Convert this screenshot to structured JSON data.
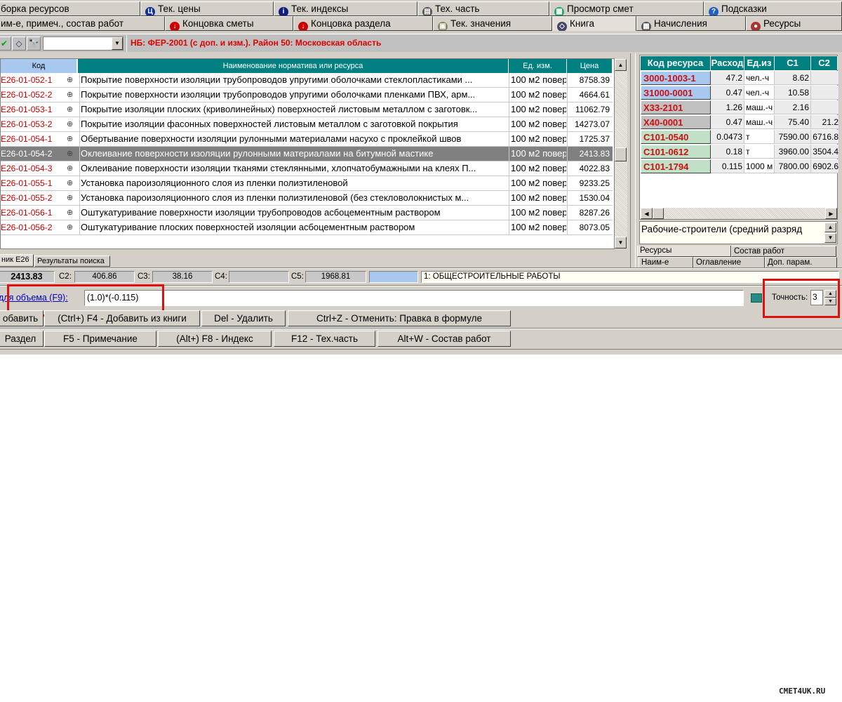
{
  "tabs_row1": [
    {
      "label": "борка ресурсов",
      "icon": ""
    },
    {
      "label": "Тек. цены",
      "icon": "prices-icon"
    },
    {
      "label": "Тек. индексы",
      "icon": "info-icon"
    },
    {
      "label": "Тех. часть",
      "icon": "pages-icon"
    },
    {
      "label": "Просмотр смет",
      "icon": "view-estimate-icon"
    },
    {
      "label": "Подсказки",
      "icon": "help-icon"
    }
  ],
  "tabs_row2": [
    {
      "label": "им-е, примеч., состав работ",
      "icon": ""
    },
    {
      "label": "Концовка сметы",
      "icon": "arrow-down-icon"
    },
    {
      "label": "Концовка раздела",
      "icon": "arrow-down-r-icon"
    },
    {
      "label": "Тек. значения",
      "icon": "values-icon"
    },
    {
      "label": "Книга",
      "icon": "book-icon"
    },
    {
      "label": "Начисления",
      "icon": "calculator-icon"
    },
    {
      "label": "Ресурсы",
      "icon": "resources-icon"
    }
  ],
  "toolbar": {
    "combo_value": "",
    "base_info": "НБ: ФЕР-2001 (с доп. и изм.). Район 50: Московская область"
  },
  "grid": {
    "headers": [
      "Код",
      "Наименование норматива или ресурса",
      "Ед. изм.",
      "Цена"
    ],
    "rows": [
      {
        "code": "E26-01-052-1",
        "name": "Покрытие поверхности изоляции трубопроводов упругими оболочками стеклопластиками ...",
        "unit": "100 м2 повер",
        "price": "8758.39"
      },
      {
        "code": "E26-01-052-2",
        "name": "Покрытие поверхности изоляции трубопроводов упругими оболочками пленками ПВХ, арм...",
        "unit": "100 м2 повер",
        "price": "4664.61"
      },
      {
        "code": "E26-01-053-1",
        "name": "Покрытие изоляции плоских (криволинейных) поверхностей листовым металлом с заготовк...",
        "unit": "100 м2 повер",
        "price": "11062.79"
      },
      {
        "code": "E26-01-053-2",
        "name": "Покрытие изоляции фасонных поверхностей листовым металлом с заготовкой покрытия",
        "unit": "100 м2 повер",
        "price": "14273.07"
      },
      {
        "code": "E26-01-054-1",
        "name": "Обертывание поверхности изоляции рулонными материалами насухо с проклейкой швов",
        "unit": "100 м2 повер",
        "price": "1725.37"
      },
      {
        "code": "E26-01-054-2",
        "name": "Оклеивание поверхности изоляции рулонными материалами на битумной мастике",
        "unit": "100 м2 повер",
        "price": "2413.83"
      },
      {
        "code": "E26-01-054-3",
        "name": "Оклеивание поверхности изоляции тканями стеклянными, хлопчатобумажными на клеях П...",
        "unit": "100 м2 повер",
        "price": "4022.83"
      },
      {
        "code": "E26-01-055-1",
        "name": "Установка пароизоляционного слоя из пленки полиэтиленовой",
        "unit": "100 м2 повер",
        "price": "9233.25"
      },
      {
        "code": "E26-01-055-2",
        "name": "Установка пароизоляционного слоя из пленки полиэтиленовой (без стекловолокнистых м...",
        "unit": "100 м2 повер",
        "price": "1530.04"
      },
      {
        "code": "E26-01-056-1",
        "name": "Оштукатуривание поверхности изоляции трубопроводов асбоцементным раствором",
        "unit": "100 м2 повер",
        "price": "8287.26"
      },
      {
        "code": "E26-01-056-2",
        "name": "Оштукатуривание плоских поверхностей изоляции асбоцементным раствором",
        "unit": "100 м2 повер",
        "price": "8073.05"
      }
    ]
  },
  "resources": {
    "headers": [
      "Код ресурса",
      "Расход",
      "Ед.из",
      "C1",
      "C2"
    ],
    "rows": [
      {
        "code": "З000-1003-1",
        "qty": "47.2",
        "unit": "чел.-ч",
        "c1": "8.62",
        "c2": "",
        "color": "#a8c8f0"
      },
      {
        "code": "З1000-0001",
        "qty": "0.47",
        "unit": "чел.-ч",
        "c1": "10.58",
        "c2": "",
        "color": "#a8c8f0"
      },
      {
        "code": "Х33-2101",
        "qty": "1.26",
        "unit": "маш.-ч",
        "c1": "2.16",
        "c2": "",
        "color": "#c0c0c0"
      },
      {
        "code": "Х40-0001",
        "qty": "0.47",
        "unit": "маш.-ч",
        "c1": "75.40",
        "c2": "21.2",
        "color": "#c0c0c0"
      },
      {
        "code": "С101-0540",
        "qty": "0.0473",
        "unit": "т",
        "c1": "7590.00",
        "c2": "6716.8",
        "color": "#c0e0c8"
      },
      {
        "code": "С101-0612",
        "qty": "0.18",
        "unit": "т",
        "c1": "3960.00",
        "c2": "3504.4",
        "color": "#c0e0c8"
      },
      {
        "code": "С101-1794",
        "qty": "0.115",
        "unit": "1000 м",
        "c1": "7800.00",
        "c2": "6902.6",
        "color": "#c0e0c8"
      }
    ],
    "memo": "Рабочие-строители (средний разряд",
    "tabs": [
      "Ресурсы",
      "Состав работ"
    ],
    "subtabs": [
      "Наим-е",
      "Оглавление",
      "Доп. парам."
    ]
  },
  "bottom_tabs": [
    "ник E26",
    "Результаты поиска"
  ],
  "status": {
    "c1": "2413.83",
    "c2_label": "C2:",
    "c2": "406.86",
    "c3_label": "C3:",
    "c3": "38.16",
    "c4_label": "C4:",
    "c4": "",
    "c5_label": "C5:",
    "c5": "1968.81",
    "section": "1: ОБЩЕСТРОИТЕЛЬНЫЕ РАБОТЫ"
  },
  "formula": {
    "label": "для объема (F9):",
    "value": "(1.0)*(-0.115)",
    "precision_label": "Точность:",
    "precision": "3"
  },
  "buttons_row1": [
    "обавить",
    "(Ctrl+) F4 - Добавить из книги",
    "Del - Удалить",
    "Ctrl+Z - Отменить: Правка в формуле"
  ],
  "buttons_row2": [
    "Раздел",
    "F5 - Примечание",
    "(Alt+) F8 - Индекс",
    "F12 - Тех.часть",
    "Alt+W - Состав работ"
  ],
  "watermark": "СМЕТ4UK.RU"
}
